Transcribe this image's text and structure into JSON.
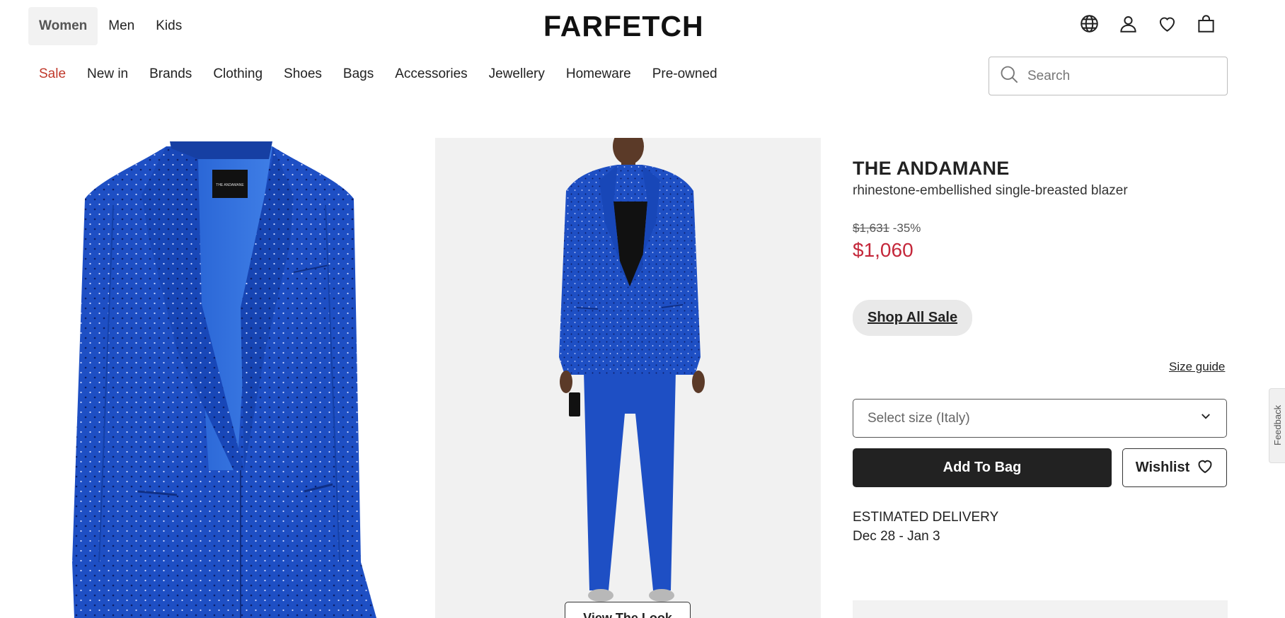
{
  "header": {
    "gender_tabs": [
      "Women",
      "Men",
      "Kids"
    ],
    "logo": "FARFETCH",
    "icons": [
      "globe-icon",
      "account-icon",
      "wishlist-heart-icon",
      "shopping-bag-icon"
    ]
  },
  "nav": {
    "categories": [
      "Sale",
      "New in",
      "Brands",
      "Clothing",
      "Shoes",
      "Bags",
      "Accessories",
      "Jewellery",
      "Homeware",
      "Pre-owned"
    ]
  },
  "search": {
    "placeholder": "Search"
  },
  "product": {
    "brand": "THE ANDAMANE",
    "description": "rhinestone-embellished single-breasted blazer",
    "original_price": "$1,631",
    "discount": "-35%",
    "sale_price": "$1,060",
    "shop_all_sale": "Shop All Sale",
    "size_guide": "Size guide",
    "size_select_placeholder": "Select size (Italy)",
    "add_to_bag": "Add To Bag",
    "wishlist": "Wishlist",
    "delivery_label": "ESTIMATED DELIVERY",
    "delivery_date": "Dec 28 - Jan 3",
    "view_the_look": "View The Look"
  },
  "feedback": "Feedback",
  "colors": {
    "sale_red": "#c4273a",
    "nav_sale": "#c0392b",
    "blazer_blue": "#1e4fc4",
    "button_dark": "#222222"
  }
}
